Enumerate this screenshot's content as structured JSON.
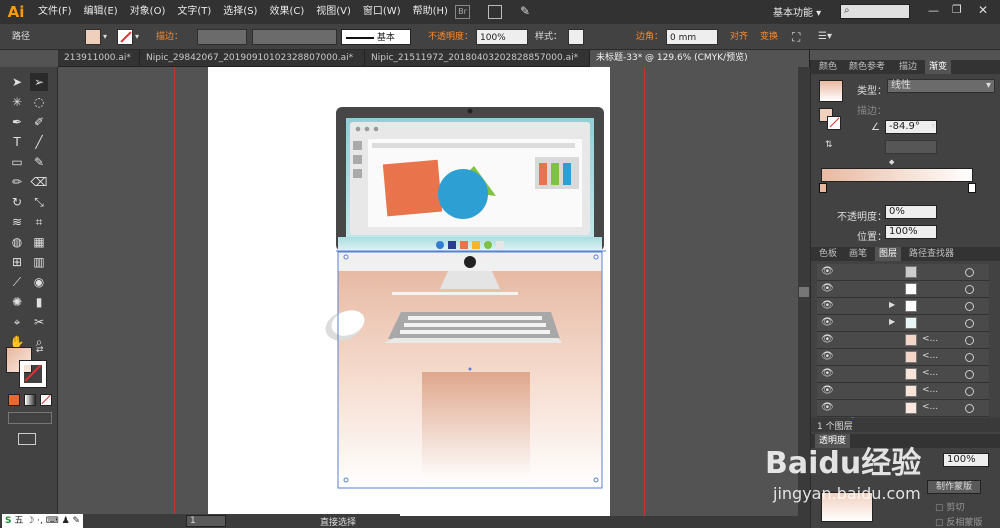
{
  "app": {
    "logo": "Ai"
  },
  "menu": [
    "文件(F)",
    "编辑(E)",
    "对象(O)",
    "文字(T)",
    "选择(S)",
    "效果(C)",
    "视图(V)",
    "窗口(W)",
    "帮助(H)"
  ],
  "workspace": {
    "label": "基本功能",
    "search_placeholder": ""
  },
  "control": {
    "selection_label": "路径",
    "stroke_label": "描边：",
    "brush_label": "基本",
    "opacity_label": "不透明度：",
    "opacity_value": "100%",
    "style_label": "样式：",
    "corner_label": "边角：",
    "corner_value": "0 mm",
    "align_label": "对齐",
    "transform_label": "变换"
  },
  "tabs": [
    {
      "label": "213911000.ai*",
      "active": false
    },
    {
      "label": "Nipic_29842067_20190910102328807000.ai*",
      "active": false
    },
    {
      "label": "Nipic_21511972_20180403202828857000.ai*",
      "active": false
    },
    {
      "label": "未标题-33* @ 129.6% (CMYK/预览)",
      "active": true
    }
  ],
  "gradient_panel": {
    "tabs": [
      "颜色",
      "颜色参考",
      "描边",
      "渐变"
    ],
    "type_label": "类型：",
    "type_value": "线性",
    "stroke_label": "描边：",
    "angle_value": "-84.9°",
    "opacity_label": "不透明度：",
    "opacity_value": "0%",
    "position_label": "位置：",
    "position_value": "100%",
    "start_color": "#e8b9a0",
    "end_color": "#ffffff"
  },
  "layers_panel": {
    "tabs": [
      "色板",
      "画笔",
      "图层",
      "路径查找器"
    ],
    "rows": [
      {
        "name": "",
        "color": "#cccccc"
      },
      {
        "name": "",
        "color": "#ffffff"
      },
      {
        "name": "",
        "color": "#ffffff"
      },
      {
        "name": "",
        "color": "#e7f5f5"
      },
      {
        "name": "<...",
        "color": "#f3d6c8"
      },
      {
        "name": "<...",
        "color": "#f3d6c8"
      },
      {
        "name": "<...",
        "color": "#f9e4da"
      },
      {
        "name": "<...",
        "color": "#f9e4da"
      },
      {
        "name": "<...",
        "color": "#fbe9df"
      }
    ],
    "footer": "1 个图层"
  },
  "transparency_panel": {
    "tab": "透明度",
    "value": "100%",
    "make_mask": "制作蒙版",
    "clip": "剪切",
    "invert": "反相蒙版"
  },
  "status": {
    "zoom": "1",
    "tool": "直接选择"
  },
  "watermark": {
    "brand": "Baidu经验",
    "url": "jingyan.baidu.com"
  },
  "ime": {
    "label": "五"
  },
  "artwork": {
    "monitor_frame": "#474747",
    "screen_bg": "#93d4d8",
    "window_bg": "#e8e8e8",
    "orange_square": "#e9734a",
    "blue_circle": "#2e9fd2",
    "green_triangle": "#7ec242",
    "bar_colors": [
      "#e9734a",
      "#7ec242",
      "#2e9fd2"
    ],
    "dock_colors": [
      "#2e7dd2",
      "#2c3e91",
      "#e9734a",
      "#f2b531",
      "#7ec242",
      "#e6e6e6"
    ]
  }
}
